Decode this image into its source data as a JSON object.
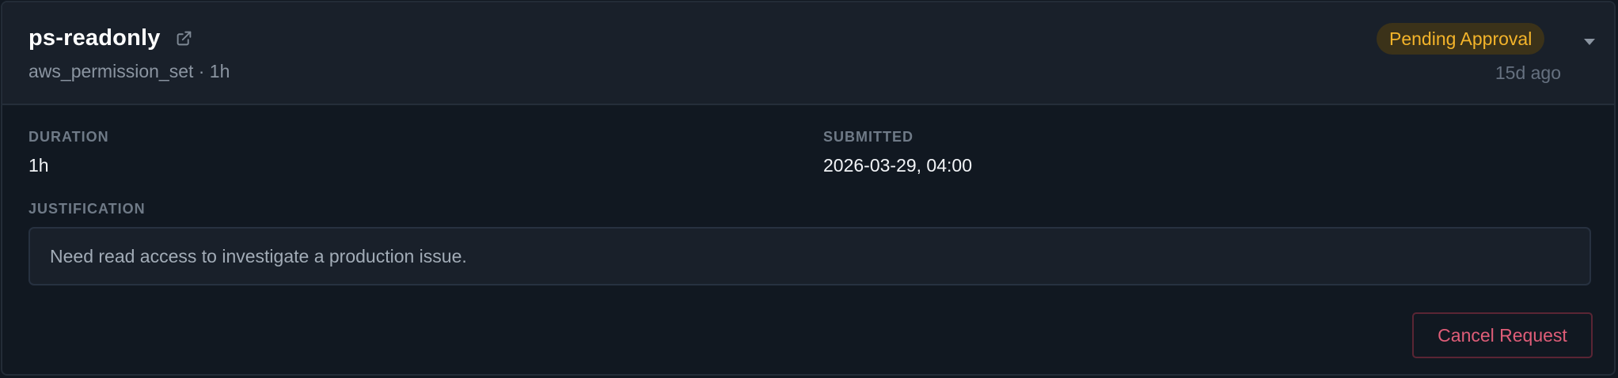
{
  "request": {
    "title": "ps-readonly",
    "subtitle": "aws_permission_set · 1h",
    "status": "Pending Approval",
    "age": "15d ago",
    "icons": {
      "open": "external-link-icon",
      "toggle": "chevron-down-icon"
    }
  },
  "details": {
    "duration_label": "DURATION",
    "duration_value": "1h",
    "submitted_label": "SUBMITTED",
    "submitted_value": "2026-03-29, 04:00",
    "justification_label": "JUSTIFICATION",
    "justification_text": "Need read access to investigate a production issue."
  },
  "actions": {
    "cancel_label": "Cancel Request"
  },
  "colors": {
    "background": "#111821",
    "header": "#19202a",
    "pending": "#f4b42a",
    "danger": "#df5d78"
  }
}
